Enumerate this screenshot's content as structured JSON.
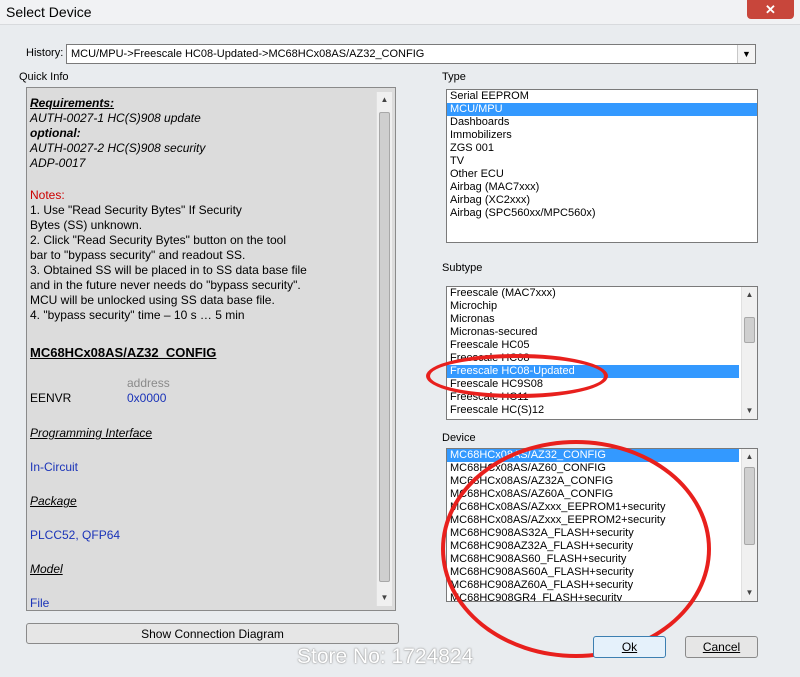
{
  "window": {
    "title": "Select Device",
    "close_glyph": "✕"
  },
  "history": {
    "label": "History:",
    "value": "MCU/MPU->Freescale HC08-Updated->MC68HCx08AS/AZ32_CONFIG"
  },
  "quick_info": {
    "label": "Quick Info",
    "requirements_title": "Requirements:",
    "req_line1": "AUTH-0027-1 HC(S)908  update",
    "optional": "optional:",
    "opt_line1": "AUTH-0027-2 HC(S)908  security",
    "opt_line2": "ADP-0017",
    "notes_title": "Notes:",
    "notes": [
      "1. Use \"Read Security Bytes\" If Security",
      "Bytes (SS) unknown.",
      "2. Click \"Read Security Bytes\" button on the tool",
      "bar to \"bypass security\" and readout SS.",
      "3. Obtained SS will be placed in to SS data base file",
      "and in the future never needs do \"bypass security\".",
      "MCU will be unlocked using SS data base file.",
      "4. \"bypass security\" time – 10 s … 5 min"
    ],
    "device_name": "MC68HCx08AS/AZ32_CONFIG",
    "address_label": "address",
    "reg_name": "EENVR",
    "reg_value": "0x0000",
    "prog_interface_label": "Programming Interface",
    "prog_interface_value": "In-Circuit",
    "package_label": "Package",
    "package_value": "PLCC52, QFP64",
    "model_label": "Model",
    "model_value": "File"
  },
  "show_diagram_button": "Show Connection Diagram",
  "type": {
    "label": "Type",
    "items": [
      "Serial EEPROM",
      "MCU/MPU",
      "Dashboards",
      "Immobilizers",
      "ZGS 001",
      "TV",
      "Other ECU",
      "Airbag (MAC7xxx)",
      "Airbag (XC2xxx)",
      "Airbag (SPC560xx/MPC560x)"
    ],
    "selected": 1
  },
  "subtype": {
    "label": "Subtype",
    "items": [
      "Freescale (MAC7xxx)",
      "Microchip",
      "Micronas",
      "Micronas-secured",
      "Freescale HC05",
      "Freescale HC08",
      "Freescale HC08-Updated",
      "Freescale HC9S08",
      "Freescale HC11",
      "Freescale HC(S)12"
    ],
    "selected": 6
  },
  "device": {
    "label": "Device",
    "items": [
      "MC68HCx08AS/AZ32_CONFIG",
      "MC68HCx08AS/AZ60_CONFIG",
      "MC68HCx08AS/AZ32A_CONFIG",
      "MC68HCx08AS/AZ60A_CONFIG",
      "MC68HCx08AS/AZxxx_EEPROM1+security",
      "MC68HCx08AS/AZxxx_EEPROM2+security",
      "MC68HC908AS32A_FLASH+security",
      "MC68HC908AZ32A_FLASH+security",
      "MC68HC908AS60_FLASH+security",
      "MC68HC908AS60A_FLASH+security",
      "MC68HC908AZ60A_FLASH+security",
      "MC68HC908GR4_FLASH+security"
    ],
    "selected": 0
  },
  "buttons": {
    "ok": "Ok",
    "cancel": "Cancel"
  },
  "watermark": "Store No: 1724824",
  "colors": {
    "selection": "#3399ff",
    "annotation_ring": "#e8201d",
    "info_blue": "#1a33b8",
    "notes_red": "#cc0000"
  }
}
